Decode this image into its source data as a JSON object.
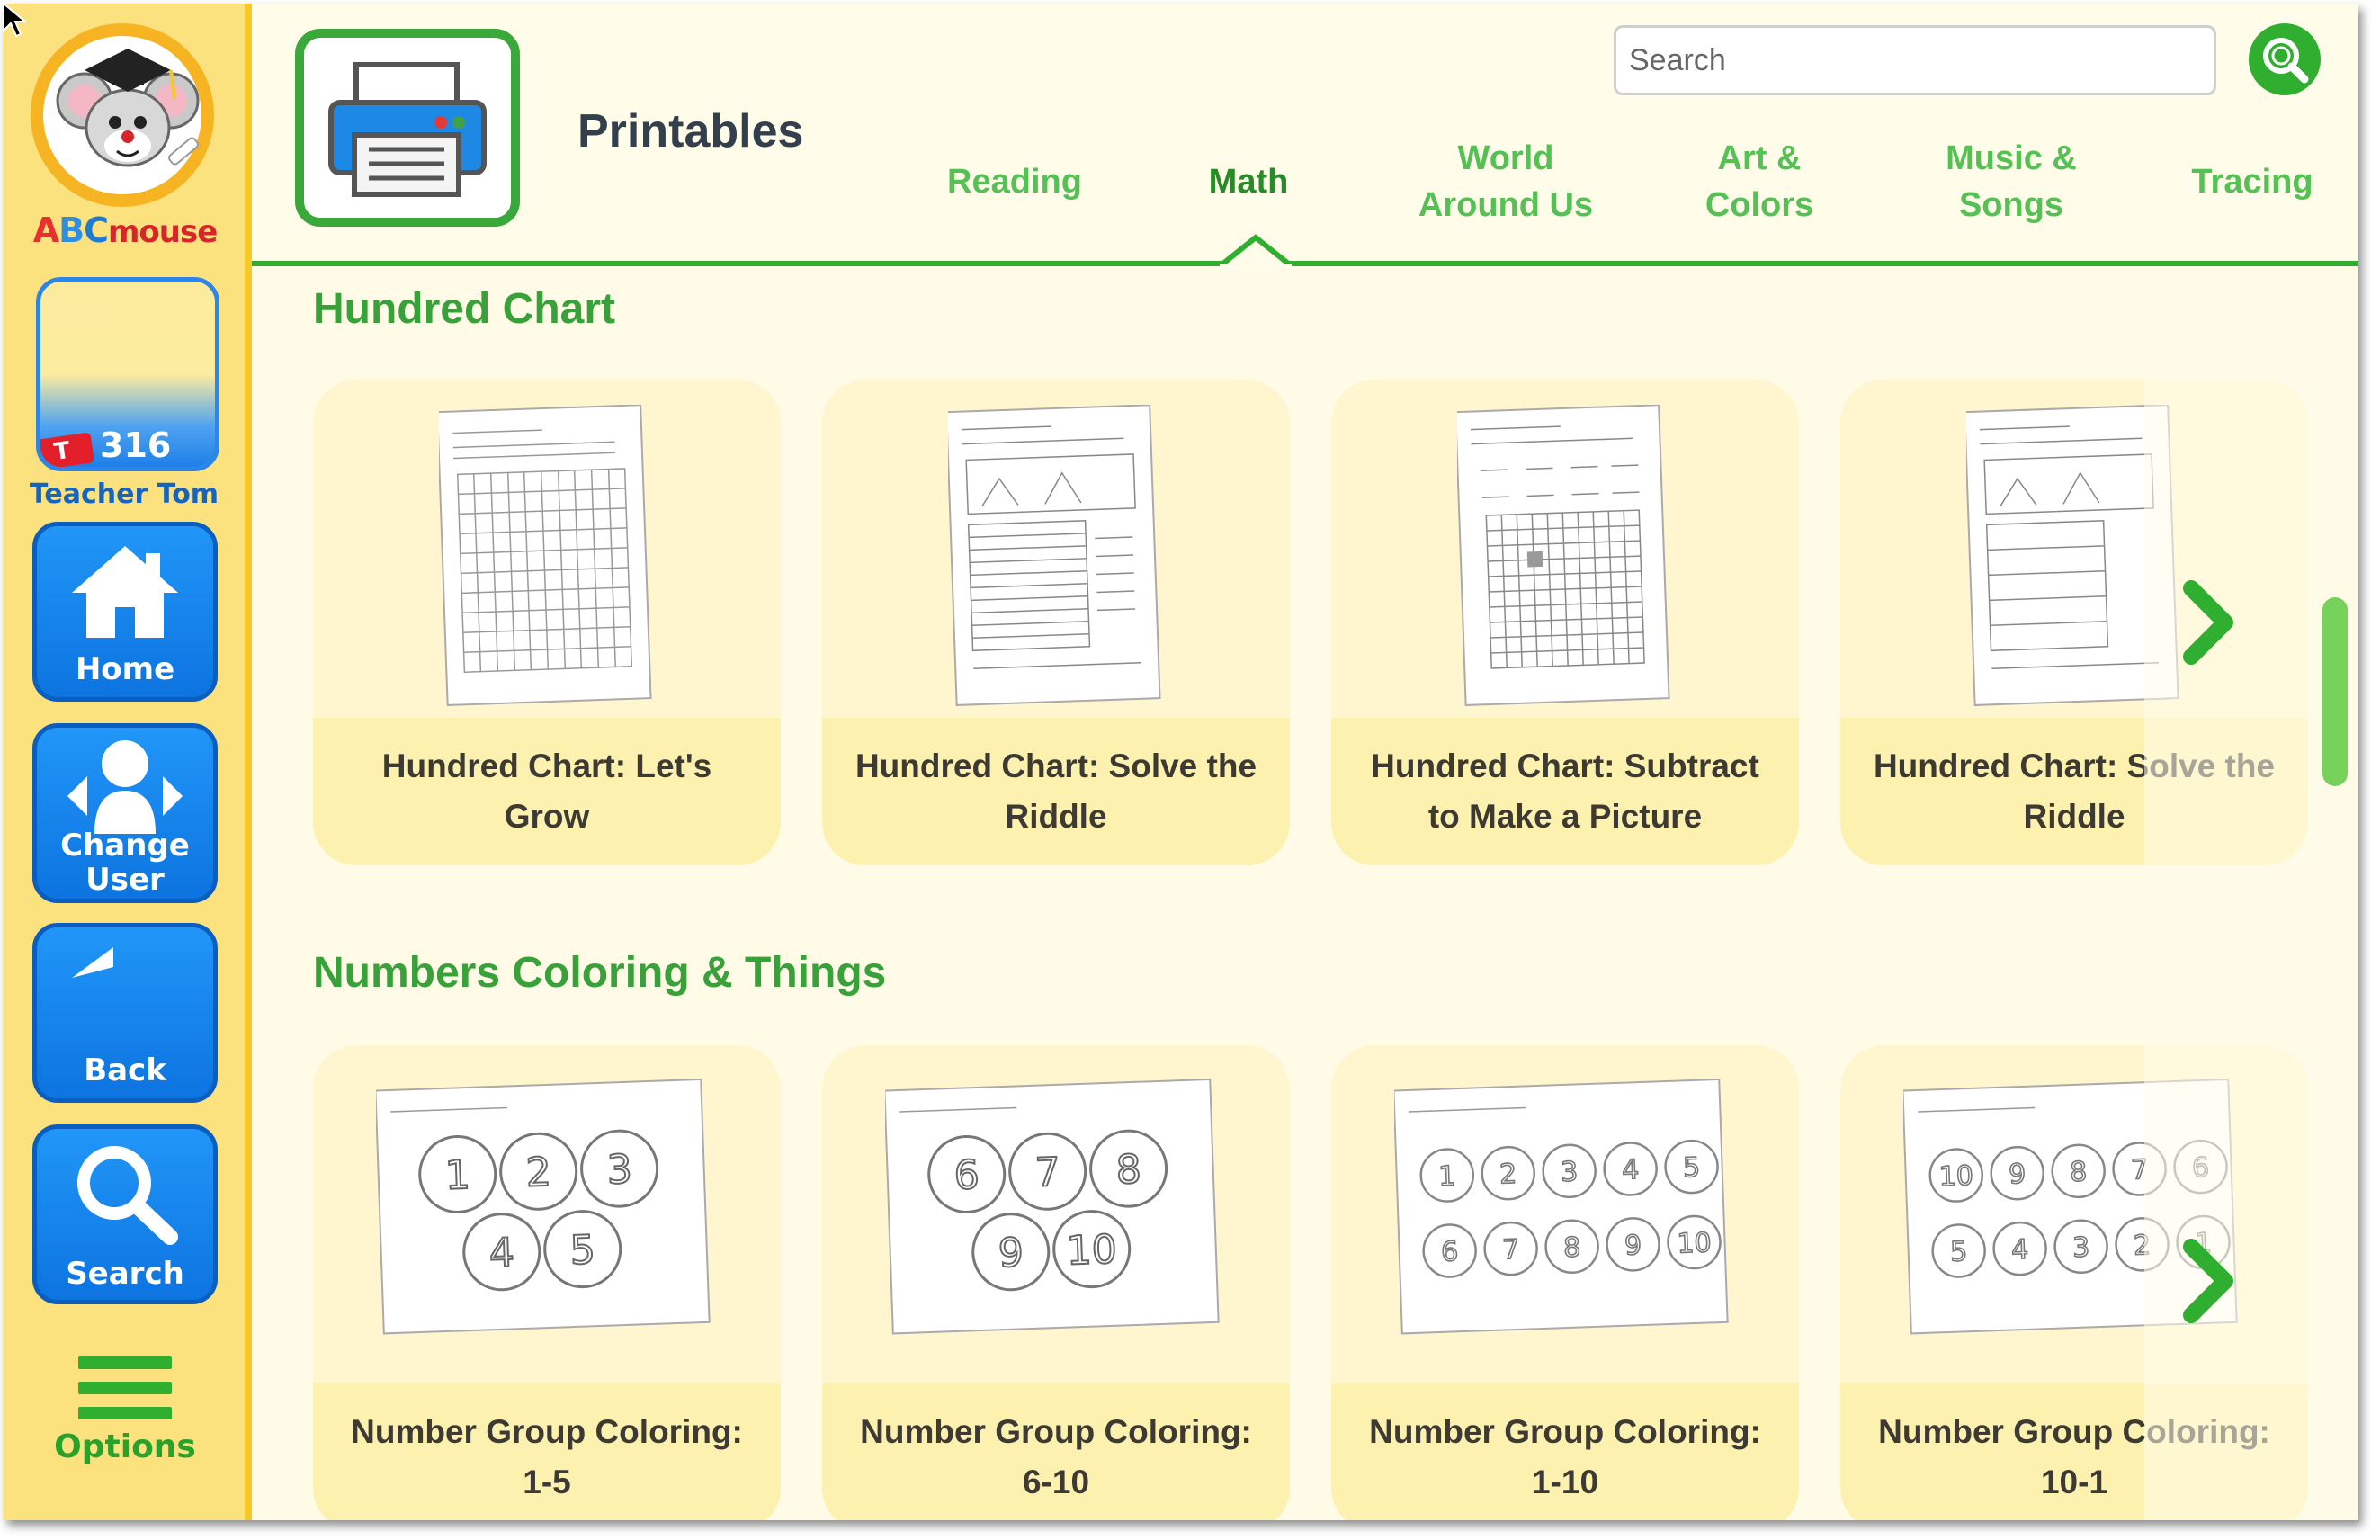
{
  "app": {
    "brand": {
      "a": "A",
      "b": "B",
      "c": "C",
      "mouse": "mouse"
    },
    "colors": {
      "accent_green": "#2fae2f",
      "button_blue": "#1a86f0",
      "sidebar_yellow": "#fbe27f"
    }
  },
  "sidebar": {
    "ticket_letter": "T",
    "ticket_count": "316",
    "user_name": "Teacher Tom",
    "buttons": [
      {
        "label": "Home",
        "icon": "home-icon"
      },
      {
        "label": "Change\nUser",
        "icon": "change-user-icon"
      },
      {
        "label": "Back",
        "icon": "back-arrow-icon"
      },
      {
        "label": "Search",
        "icon": "search-icon"
      }
    ],
    "options_label": "Options"
  },
  "header": {
    "title": "Printables",
    "search_placeholder": "Search",
    "tabs": [
      {
        "label": "Reading"
      },
      {
        "label": "Math"
      },
      {
        "label": "World\nAround Us"
      },
      {
        "label": "Art &\nColors"
      },
      {
        "label": "Music &\nSongs"
      },
      {
        "label": "Tracing"
      }
    ],
    "active_tab": "Math"
  },
  "sections": [
    {
      "title": "Hundred Chart",
      "items": [
        {
          "title": "Hundred Chart: Let's Grow"
        },
        {
          "title": "Hundred Chart: Solve the Riddle"
        },
        {
          "title": "Hundred Chart: Subtract to Make a Picture"
        },
        {
          "title": "Hundred Chart: Solve the Riddle"
        }
      ]
    },
    {
      "title": "Numbers Coloring & Things",
      "items": [
        {
          "title": "Number Group Coloring: 1-5",
          "numbers": [
            "1",
            "2",
            "3",
            "4",
            "5"
          ]
        },
        {
          "title": "Number Group Coloring: 6-10",
          "numbers": [
            "6",
            "7",
            "8",
            "9",
            "10"
          ]
        },
        {
          "title": "Number Group Coloring: 1-10",
          "numbers": [
            "1",
            "2",
            "3",
            "4",
            "5",
            "6",
            "7",
            "8",
            "9",
            "10"
          ]
        },
        {
          "title": "Number Group Coloring: 10-1",
          "numbers": [
            "10",
            "9",
            "8",
            "7",
            "6",
            "5",
            "4",
            "3",
            "2",
            "1"
          ]
        }
      ]
    }
  ]
}
